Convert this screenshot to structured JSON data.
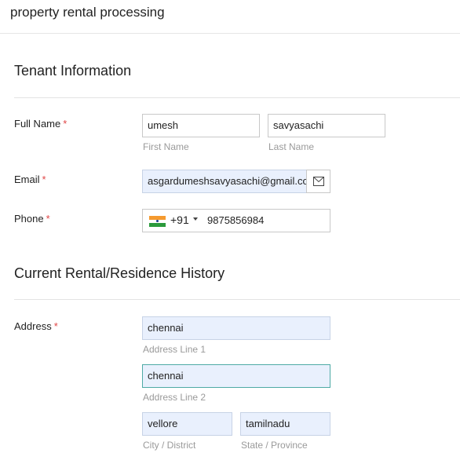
{
  "app": {
    "title": "property rental processing"
  },
  "sections": {
    "tenant": "Tenant Information",
    "history": "Current Rental/Residence History"
  },
  "full_name": {
    "label": "Full Name",
    "first_value": "umesh",
    "first_hint": "First Name",
    "last_value": "savyasachi",
    "last_hint": "Last Name"
  },
  "email": {
    "label": "Email",
    "value": "asgardumeshsavyasachi@gmail.cor",
    "icon": "envelope-icon"
  },
  "phone": {
    "label": "Phone",
    "country_flag": "india-flag-icon",
    "dial_code": "+91",
    "number": "9875856984"
  },
  "address": {
    "label": "Address",
    "line1_value": "chennai",
    "line1_hint": "Address Line 1",
    "line2_value": "chennai",
    "line2_hint": "Address Line 2",
    "city_value": "vellore",
    "city_hint": "City / District",
    "state_value": "tamilnadu",
    "state_hint": "State / Province"
  },
  "required_marker": "*",
  "colors": {
    "required": "#e04545",
    "filled_bg": "#e9f0fd",
    "focus_border": "#4eaaa5",
    "hint": "#9a9a9a"
  }
}
